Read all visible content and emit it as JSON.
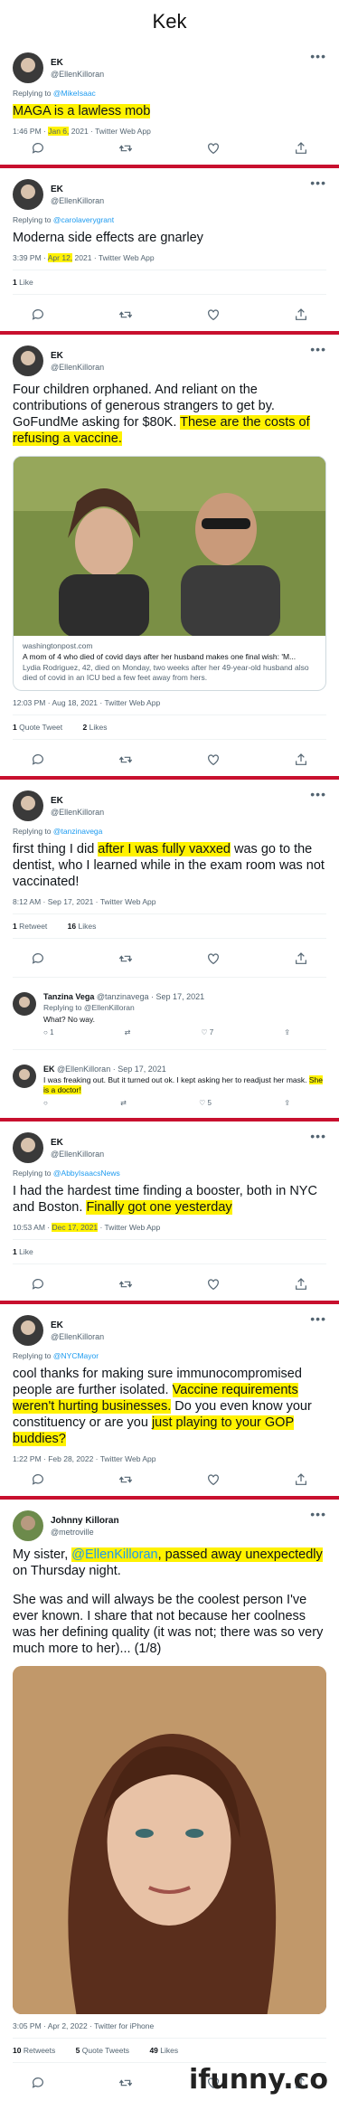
{
  "page_title": "Kek",
  "tweets": [
    {
      "name": "EK",
      "handle": "@EllenKilloran",
      "replying_label": "Replying to",
      "replying_to": "@MikeIsaac",
      "text_hl": "MAGA is a lawless mob",
      "time": "1:46 PM ·",
      "date": "Jan 6,",
      "year_app": "2021 · Twitter Web App"
    },
    {
      "name": "EK",
      "handle": "@EllenKilloran",
      "replying_label": "Replying to",
      "replying_to": "@carolaverygrant",
      "text": "Moderna side effects are gnarley",
      "time": "3:39 PM ·",
      "date": "Apr 12,",
      "year_app": "2021 · Twitter Web App",
      "likes_count": "1",
      "likes_label": "Like"
    },
    {
      "name": "EK",
      "handle": "@EllenKilloran",
      "text_plain": "Four children orphaned. And reliant on the contributions of generous strangers to get by. GoFundMe asking for $80K.",
      "text_hl": "These are the costs of refusing a vaccine.",
      "card_domain": "washingtonpost.com",
      "card_title": "A mom of 4 who died of covid days after her husband makes one final wish: 'M...",
      "card_desc": "Lydia Rodriguez, 42, died on Monday, two weeks after her 49-year-old husband also died of covid in an ICU bed a few feet away from hers.",
      "meta": "12:03 PM · Aug 18, 2021 · Twitter Web App",
      "quote_count": "1",
      "quote_label": "Quote Tweet",
      "likes_count": "2",
      "likes_label": "Likes"
    },
    {
      "name": "EK",
      "handle": "@EllenKilloran",
      "replying_label": "Replying to",
      "replying_to": "@tanzinavega",
      "text_a": "first thing I did",
      "text_hl": "after I was fully vaxxed",
      "text_b": "was go to the dentist, who I learned while in the exam room was not vaccinated!",
      "meta": "8:12 AM · Sep 17, 2021 · Twitter Web App",
      "retweet_count": "1",
      "retweet_label": "Retweet",
      "likes_count": "16",
      "likes_label": "Likes",
      "reply1": {
        "name": "Tanzina Vega",
        "handle_date": "@tanzinavega · Sep 17, 2021",
        "replying": "Replying to @EllenKilloran",
        "text": "What? No way.",
        "replies": "1",
        "likes": "7"
      },
      "reply2": {
        "name": "EK",
        "handle_date": "@EllenKilloran · Sep 17, 2021",
        "text": "I was freaking out. But it turned out ok. I kept asking her to readjust her mask.",
        "text_hl": "She is a doctor!",
        "likes": "5"
      }
    },
    {
      "name": "EK",
      "handle": "@EllenKilloran",
      "replying_label": "Replying to",
      "replying_to": "@AbbyIsaacsNews",
      "text_plain": "I had the hardest time finding a booster, both in NYC and Boston.",
      "text_hl": "Finally got one yesterday",
      "time": "10:53 AM ·",
      "date": "Dec 17, 2021",
      "app": "· Twitter Web App",
      "likes_count": "1",
      "likes_label": "Like"
    },
    {
      "name": "EK",
      "handle": "@EllenKilloran",
      "replying_label": "Replying to",
      "replying_to": "@NYCMayor",
      "text_plain": "cool thanks for making sure immunocompromised people are further isolated.",
      "text_hl": "Vaccine requirements weren't hurting businesses.",
      "text_b": "Do you even know your constituency or are you",
      "text_hl2": "just playing to your GOP buddies?",
      "meta": "1:22 PM · Feb 28, 2022 · Twitter Web App"
    },
    {
      "name": "Johnny Killoran",
      "handle": "@metroville",
      "text_a": "My sister,",
      "mention": "@EllenKilloran",
      "text_hl": ", passed away unexpectedly",
      "text_b": "on Thursday night.",
      "text_c": "She was and will always be the coolest person I've ever known. I share that not because her coolness was her defining quality (it was not; there was so very much more to her)... (1/8)",
      "meta": "3:05 PM · Apr 2, 2022 · Twitter for iPhone",
      "retweet_count": "10",
      "retweet_label": "Retweets",
      "quote_count": "5",
      "quote_label": "Quote Tweets",
      "likes_count": "49",
      "likes_label": "Likes"
    }
  ],
  "brand": "ifunny.co",
  "colors": {
    "divider": "#c8102e",
    "highlight": "#fff200",
    "link": "#1d9bf0"
  }
}
